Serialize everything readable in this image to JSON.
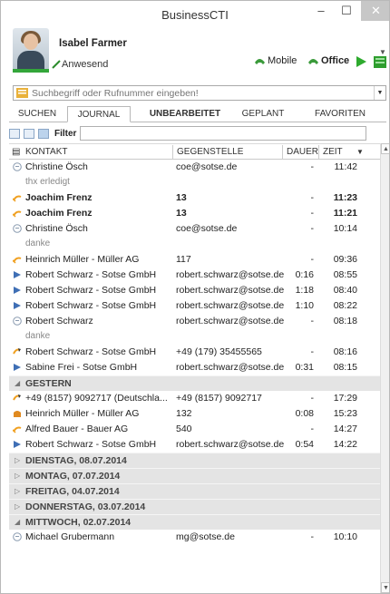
{
  "window": {
    "title": "BusinessCTI",
    "minimize": "–",
    "maximize": "☐",
    "close": "✕"
  },
  "user": {
    "name": "Isabel Farmer",
    "status": "Anwesend"
  },
  "lines": {
    "mobile": "Mobile",
    "office": "Office"
  },
  "search": {
    "placeholder": "Suchbegriff oder Rufnummer eingeben!",
    "value": ""
  },
  "tabs": [
    "SUCHEN",
    "JOURNAL",
    "UNBEARBEITET",
    "GEPLANT",
    "FAVORITEN"
  ],
  "active_tab": "JOURNAL",
  "toolbar": {
    "filter_label": "Filter"
  },
  "columns": {
    "contact": "KONTAKT",
    "remote": "GEGENSTELLE",
    "duration": "DAUER",
    "time": "ZEIT"
  },
  "today_rows": [
    {
      "icon": "chat",
      "contact": "Christine Ösch",
      "remote": "coe@sotse.de",
      "duration": "-",
      "time": "11:42",
      "note": "thx erledigt",
      "bold": false
    },
    {
      "icon": "missed-call",
      "contact": "Joachim Frenz",
      "remote": "13",
      "duration": "-",
      "time": "11:23",
      "note": "",
      "bold": true
    },
    {
      "icon": "missed-call",
      "contact": "Joachim Frenz",
      "remote": "13",
      "duration": "-",
      "time": "11:21",
      "note": "",
      "bold": true
    },
    {
      "icon": "chat",
      "contact": "Christine Ösch",
      "remote": "coe@sotse.de",
      "duration": "-",
      "time": "10:14",
      "note": "danke",
      "bold": false
    },
    {
      "icon": "missed-call",
      "contact": "Heinrich Müller - Müller AG",
      "remote": "117",
      "duration": "-",
      "time": "09:36",
      "note": "",
      "bold": false
    },
    {
      "icon": "video",
      "contact": "Robert Schwarz - Sotse GmbH",
      "remote": "robert.schwarz@sotse.de",
      "duration": "0:16",
      "time": "08:55",
      "note": "",
      "bold": false
    },
    {
      "icon": "video",
      "contact": "Robert Schwarz - Sotse GmbH",
      "remote": "robert.schwarz@sotse.de",
      "duration": "1:18",
      "time": "08:40",
      "note": "",
      "bold": false
    },
    {
      "icon": "video",
      "contact": "Robert Schwarz - Sotse GmbH",
      "remote": "robert.schwarz@sotse.de",
      "duration": "1:10",
      "time": "08:22",
      "note": "",
      "bold": false
    },
    {
      "icon": "chat",
      "contact": "Robert Schwarz",
      "remote": "robert.schwarz@sotse.de",
      "duration": "-",
      "time": "08:18",
      "note": "danke",
      "bold": false
    },
    {
      "icon": "outgoing-call",
      "contact": "Robert Schwarz - Sotse GmbH",
      "remote": "+49 (179) 35455565",
      "duration": "-",
      "time": "08:16",
      "note": "",
      "bold": false
    },
    {
      "icon": "video",
      "contact": "Sabine Frei - Sotse GmbH",
      "remote": "robert.schwarz@sotse.de",
      "duration": "0:31",
      "time": "08:15",
      "note": "",
      "bold": false
    }
  ],
  "yesterday_group": "GESTERN",
  "yesterday_rows": [
    {
      "icon": "outgoing-call",
      "contact": "+49 (8157) 9092717  (Deutschla...",
      "remote": "+49 (8157) 9092717",
      "duration": "-",
      "time": "17:29",
      "note": "",
      "bold": false
    },
    {
      "icon": "answered-call",
      "contact": "Heinrich Müller - Müller AG",
      "remote": "132",
      "duration": "0:08",
      "time": "15:23",
      "note": "",
      "bold": false
    },
    {
      "icon": "missed-call",
      "contact": "Alfred Bauer - Bauer AG",
      "remote": "540",
      "duration": "-",
      "time": "14:27",
      "note": "",
      "bold": false
    },
    {
      "icon": "video",
      "contact": "Robert Schwarz - Sotse GmbH",
      "remote": "robert.schwarz@sotse.de",
      "duration": "0:54",
      "time": "14:22",
      "note": "",
      "bold": false
    }
  ],
  "collapsed_groups": [
    "DIENSTAG, 08.07.2014",
    "MONTAG, 07.07.2014",
    "FREITAG, 04.07.2014",
    "DONNERSTAG, 03.07.2014"
  ],
  "wednesday_group": "MITTWOCH, 02.07.2014",
  "wednesday_rows": [
    {
      "icon": "chat",
      "contact": "Michael Grubermann",
      "remote": "mg@sotse.de",
      "duration": "-",
      "time": "10:10",
      "note": "",
      "bold": false
    }
  ],
  "colors": {
    "accent_green": "#33a63a",
    "missed_orange": "#f0a020",
    "video_blue": "#3f6fb5",
    "group_bg": "#e4e4e4",
    "close_bg": "#c7c7c7"
  }
}
